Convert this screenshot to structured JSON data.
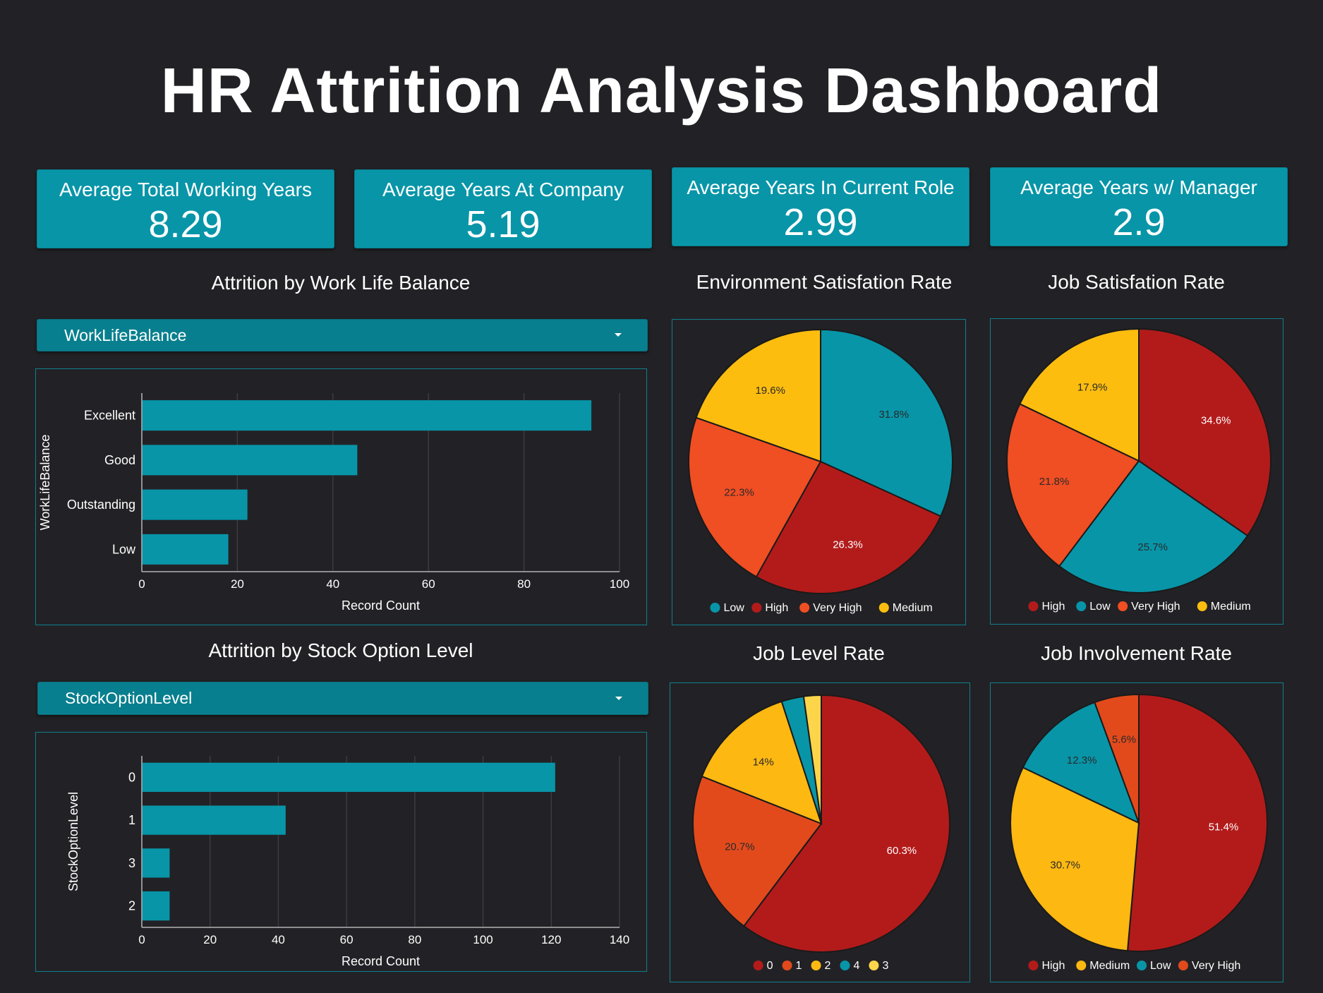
{
  "title": "HR Attrition Analysis Dashboard",
  "colors": {
    "background": "#222226",
    "teal": "#0895a8",
    "dark_red": "#b31b1b",
    "orange": "#f04e23",
    "yellow": "#fdbd0f",
    "panel_border": "#0f7f8c"
  },
  "kpis": [
    {
      "label": "Average Total Working Years",
      "value": "8.29"
    },
    {
      "label": "Average Years At Company",
      "value": "5.19"
    },
    {
      "label": "Average Years In Current Role",
      "value": "2.99"
    },
    {
      "label": "Average Years w/ Manager",
      "value": "2.9"
    }
  ],
  "work_life": {
    "section_title": "Attrition by Work Life Balance",
    "dropdown_value": "WorkLifeBalance"
  },
  "stock": {
    "section_title": "Attrition by Stock Option Level",
    "dropdown_value": "StockOptionLevel"
  },
  "chart_data": [
    {
      "id": "worklife",
      "type": "bar",
      "orientation": "horizontal",
      "categories": [
        "Excellent",
        "Good",
        "Outstanding",
        "Low"
      ],
      "values": [
        94,
        45,
        22,
        18
      ],
      "xlabel": "Record Count",
      "ylabel": "WorkLifeBalance",
      "xlim": [
        0,
        100
      ],
      "xticks": [
        0,
        20,
        40,
        60,
        80,
        100
      ],
      "grid": true,
      "color": "#0895a8"
    },
    {
      "id": "stock",
      "type": "bar",
      "orientation": "horizontal",
      "categories": [
        "0",
        "1",
        "3",
        "2"
      ],
      "values": [
        121,
        42,
        8,
        8
      ],
      "xlabel": "Record Count",
      "ylabel": "StockOptionLevel",
      "xlim": [
        0,
        140
      ],
      "xticks": [
        0,
        20,
        40,
        60,
        80,
        100,
        120,
        140
      ],
      "grid": true,
      "color": "#0895a8"
    },
    {
      "id": "env",
      "type": "pie",
      "title": "Environment Satisfation Rate",
      "slices": [
        {
          "label": "Low",
          "value": 31.8,
          "display": "31.8%",
          "color": "#0895a8"
        },
        {
          "label": "High",
          "value": 26.3,
          "display": "26.3%",
          "color": "#b31b1b"
        },
        {
          "label": "Very High",
          "value": 22.3,
          "display": "22.3%",
          "color": "#f04e23"
        },
        {
          "label": "Medium",
          "value": 19.6,
          "display": "19.6%",
          "color": "#fdbd0f"
        }
      ],
      "legend_position": "bottom"
    },
    {
      "id": "jobsat",
      "type": "pie",
      "title": "Job Satisfation Rate",
      "slices": [
        {
          "label": "High",
          "value": 34.6,
          "display": "34.6%",
          "color": "#b31b1b"
        },
        {
          "label": "Low",
          "value": 25.7,
          "display": "25.7%",
          "color": "#0895a8"
        },
        {
          "label": "Very High",
          "value": 21.8,
          "display": "21.8%",
          "color": "#f04e23"
        },
        {
          "label": "Medium",
          "value": 17.9,
          "display": "17.9%",
          "color": "#fdbd0f"
        }
      ],
      "legend_position": "bottom"
    },
    {
      "id": "joblevel",
      "type": "pie",
      "title": "Job Level Rate",
      "slices": [
        {
          "label": "0",
          "value": 60.3,
          "display": "60.3%",
          "color": "#b31b1b"
        },
        {
          "label": "1",
          "value": 20.7,
          "display": "20.7%",
          "color": "#e24a1c"
        },
        {
          "label": "2",
          "value": 14,
          "display": "14%",
          "color": "#fdb812"
        },
        {
          "label": "4",
          "value": 2.8,
          "display": "",
          "color": "#0895a8"
        },
        {
          "label": "3",
          "value": 2.2,
          "display": "",
          "color": "#fdd54a"
        }
      ],
      "legend_position": "bottom"
    },
    {
      "id": "jobinv",
      "type": "pie",
      "title": "Job Involvement Rate",
      "slices": [
        {
          "label": "High",
          "value": 51.4,
          "display": "51.4%",
          "color": "#b31b1b"
        },
        {
          "label": "Medium",
          "value": 30.7,
          "display": "30.7%",
          "color": "#fdb812"
        },
        {
          "label": "Low",
          "value": 12.3,
          "display": "12.3%",
          "color": "#0895a8"
        },
        {
          "label": "Very High",
          "value": 5.6,
          "display": "5.6%",
          "color": "#e24a1c"
        }
      ],
      "legend_position": "bottom"
    }
  ]
}
